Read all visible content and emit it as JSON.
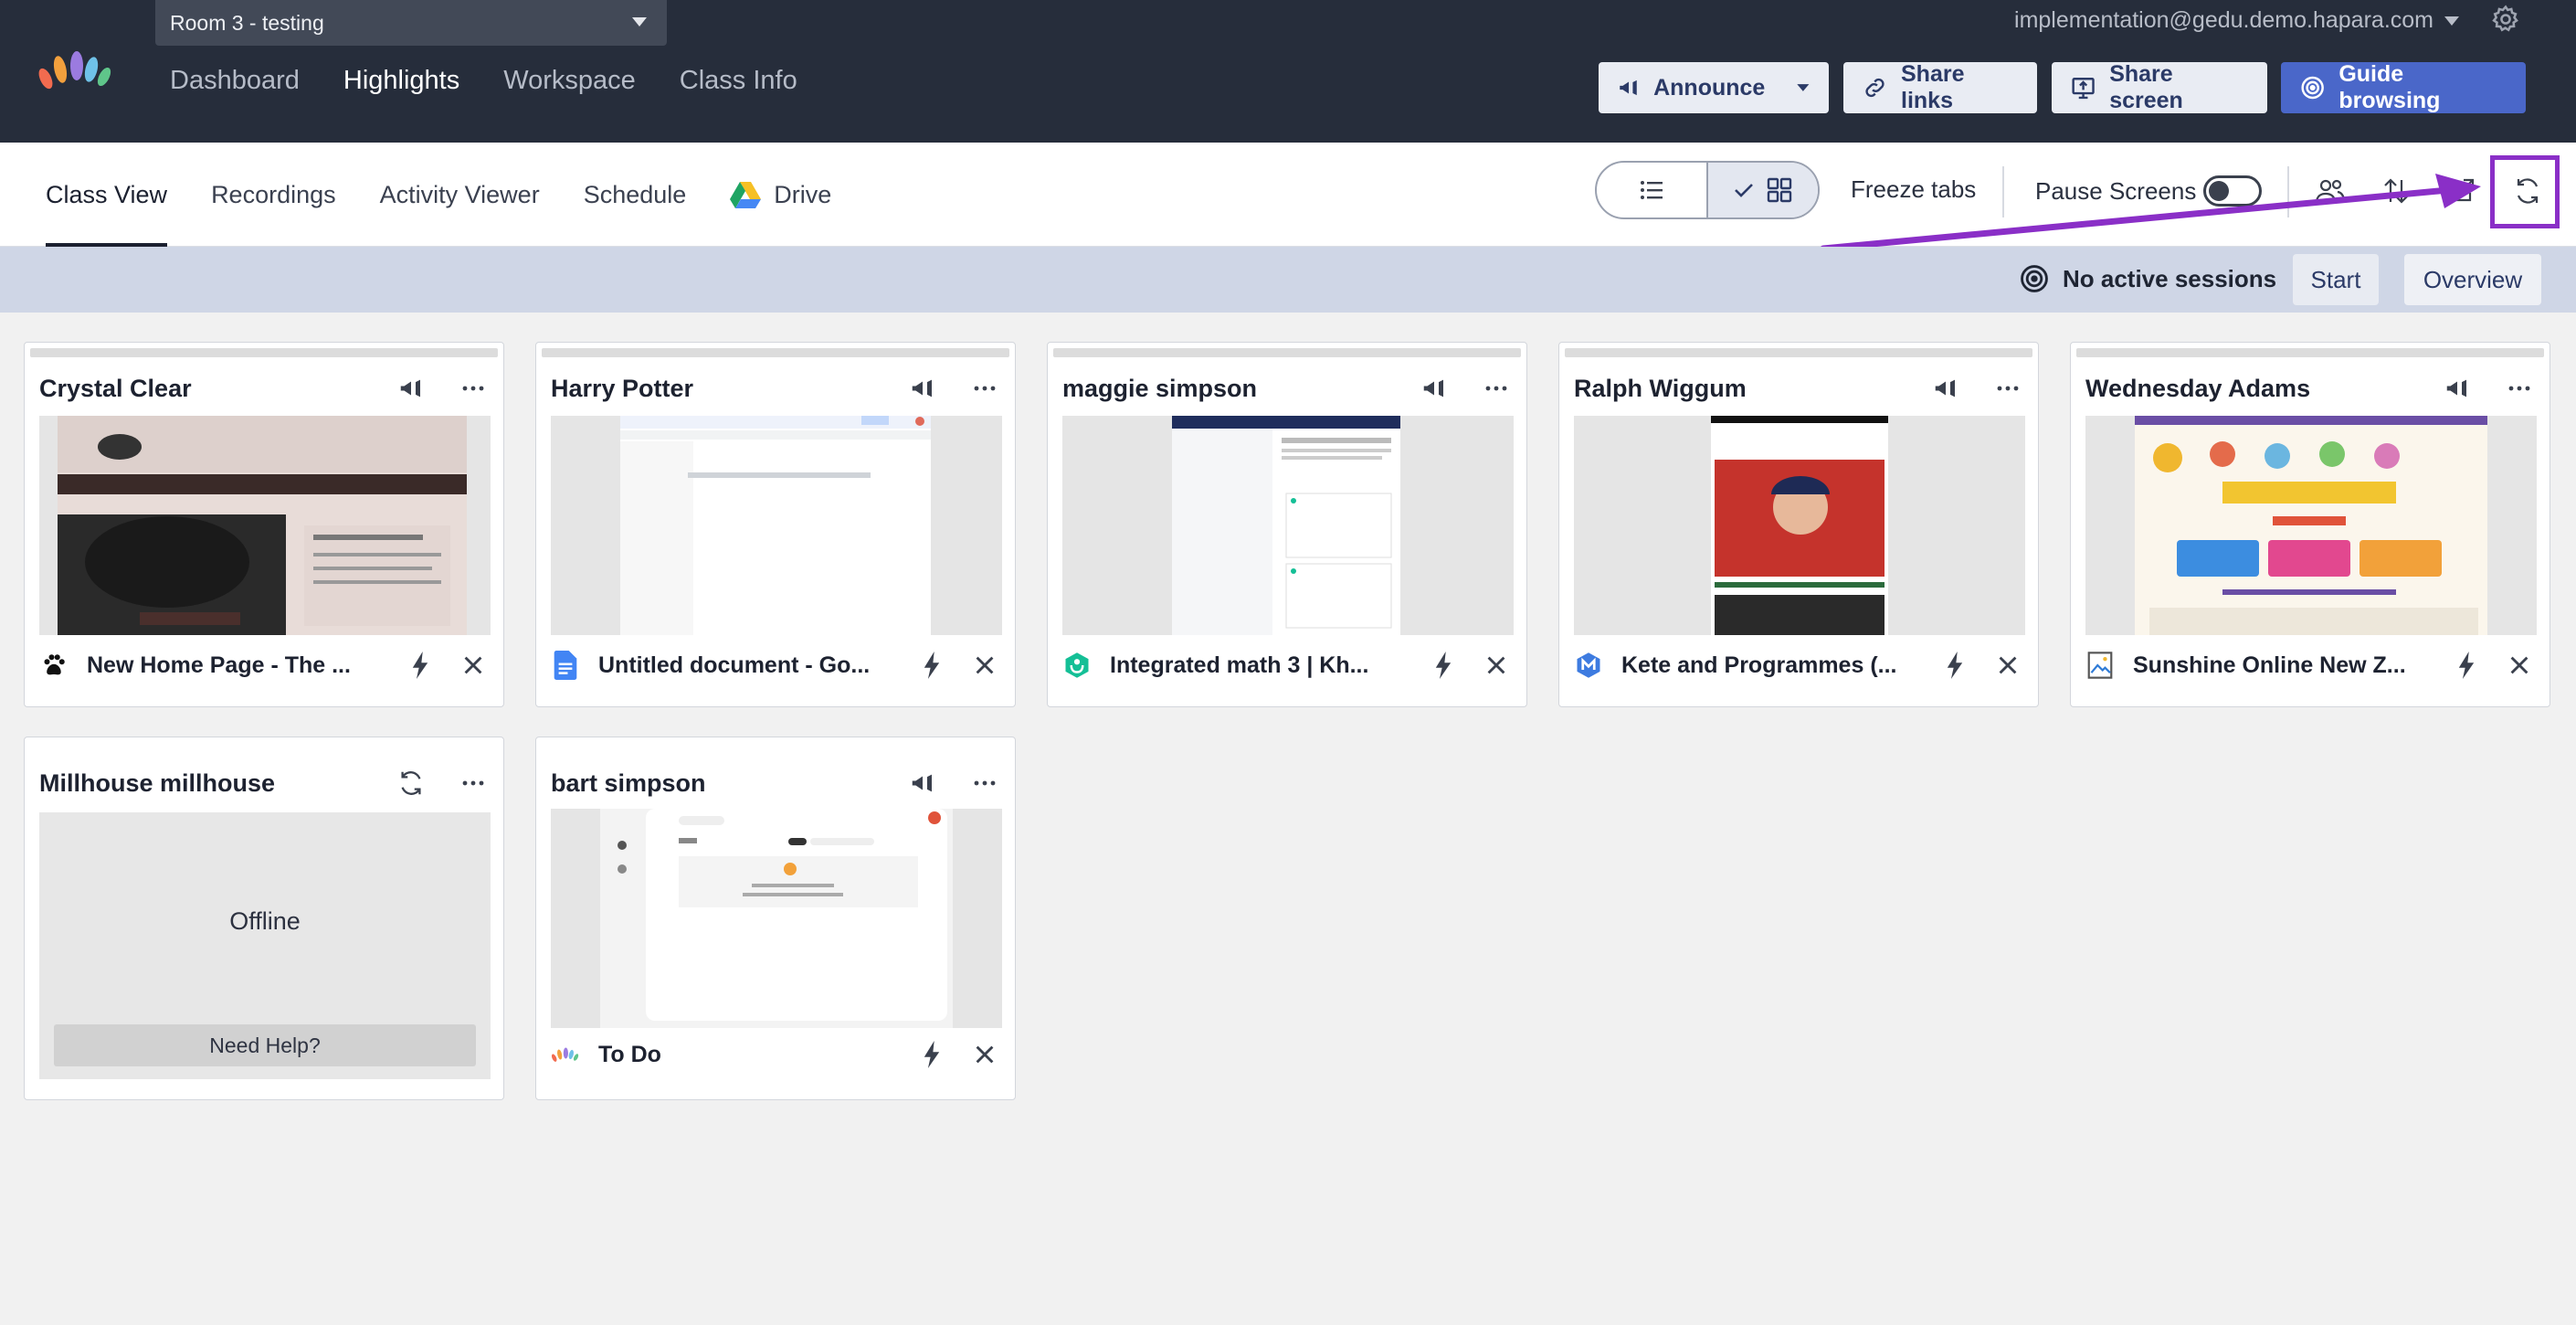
{
  "header": {
    "room": "Room 3 - testing",
    "nav": [
      "Dashboard",
      "Highlights",
      "Workspace",
      "Class Info"
    ],
    "active_nav": "Highlights",
    "user_email": "implementation@gedu.demo.hapara.com",
    "buttons": {
      "announce": "Announce",
      "share_links": "Share links",
      "share_screen": "Share screen",
      "guide_browsing": "Guide browsing"
    }
  },
  "toolbar": {
    "tabs": [
      "Class View",
      "Recordings",
      "Activity Viewer",
      "Schedule",
      "Drive"
    ],
    "active_tab": "Class View",
    "freeze_tabs": "Freeze tabs",
    "pause_screens": "Pause Screens",
    "pause_screens_on": false,
    "view_mode": "grid"
  },
  "session": {
    "status": "No active sessions",
    "start": "Start",
    "overview": "Overview"
  },
  "colors": {
    "topbar": "#262d3b",
    "accent": "#4a67c9",
    "annotation": "#8a2fc7"
  },
  "students": [
    {
      "name": "Crystal Clear",
      "tab_title": "New Home Page - The ...",
      "favicon": "paw-icon"
    },
    {
      "name": "Harry Potter",
      "tab_title": "Untitled document - Go...",
      "favicon": "google-docs-icon"
    },
    {
      "name": "maggie simpson",
      "tab_title": "Integrated math 3 | Kh...",
      "favicon": "khan-academy-icon"
    },
    {
      "name": "Ralph Wiggum",
      "tab_title": "Kete and Programmes (...",
      "favicon": "m-badge-icon"
    },
    {
      "name": "Wednesday Adams",
      "tab_title": "Sunshine Online New Z...",
      "favicon": "image-file-icon"
    },
    {
      "name": "Millhouse millhouse",
      "status": "Offline",
      "help": "Need Help?"
    },
    {
      "name": "bart simpson",
      "tab_title": "To Do",
      "favicon": "hapara-logo-icon"
    }
  ]
}
